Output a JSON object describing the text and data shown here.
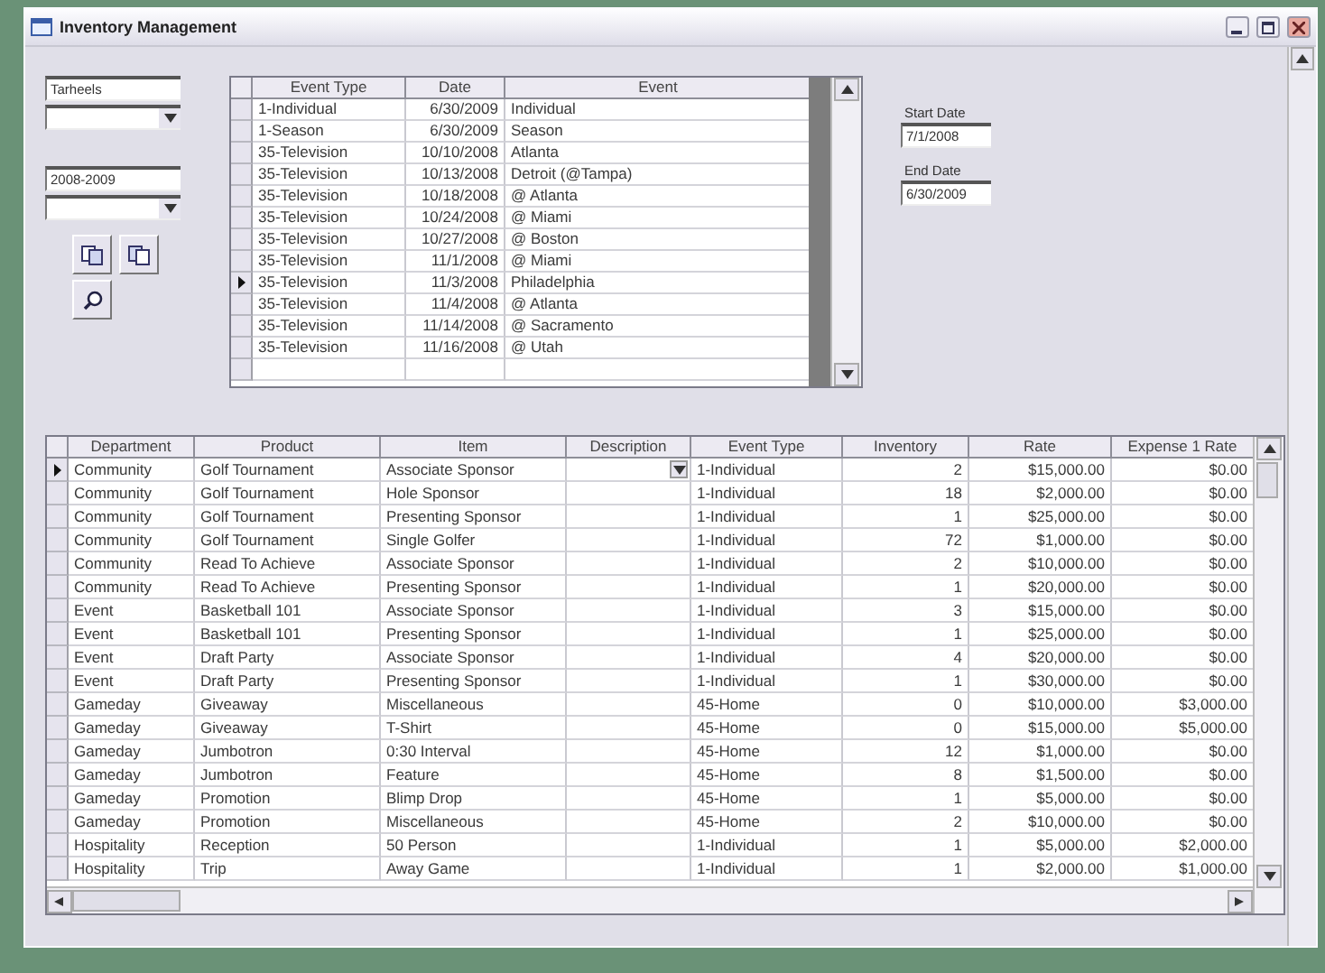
{
  "window": {
    "title": "Inventory Management"
  },
  "filters": {
    "team": {
      "value": "Tarheels"
    },
    "season": {
      "value": "2008-2009"
    }
  },
  "events_grid": {
    "columns": [
      {
        "label": "Event Type",
        "kind": "text"
      },
      {
        "label": "Date",
        "kind": "number"
      },
      {
        "label": "Event",
        "kind": "text"
      }
    ],
    "rows": [
      {
        "selected": false,
        "cells": [
          "1-Individual",
          "6/30/2009",
          "Individual"
        ]
      },
      {
        "selected": false,
        "cells": [
          "1-Season",
          "6/30/2009",
          "Season"
        ]
      },
      {
        "selected": false,
        "cells": [
          "35-Television",
          "10/10/2008",
          "Atlanta"
        ]
      },
      {
        "selected": false,
        "cells": [
          "35-Television",
          "10/13/2008",
          "Detroit (@Tampa)"
        ]
      },
      {
        "selected": false,
        "cells": [
          "35-Television",
          "10/18/2008",
          "@ Atlanta"
        ]
      },
      {
        "selected": false,
        "cells": [
          "35-Television",
          "10/24/2008",
          "@ Miami"
        ]
      },
      {
        "selected": false,
        "cells": [
          "35-Television",
          "10/27/2008",
          "@ Boston"
        ]
      },
      {
        "selected": false,
        "cells": [
          "35-Television",
          "11/1/2008",
          "@ Miami"
        ]
      },
      {
        "selected": true,
        "cells": [
          "35-Television",
          "11/3/2008",
          "Philadelphia"
        ]
      },
      {
        "selected": false,
        "cells": [
          "35-Television",
          "11/4/2008",
          "@ Atlanta"
        ]
      },
      {
        "selected": false,
        "cells": [
          "35-Television",
          "11/14/2008",
          "@ Sacramento"
        ]
      },
      {
        "selected": false,
        "cells": [
          "35-Television",
          "11/16/2008",
          "@ Utah"
        ]
      }
    ]
  },
  "dates": {
    "start": {
      "label": "Start Date",
      "value": "7/1/2008"
    },
    "end": {
      "label": "End Date",
      "value": "6/30/2009"
    }
  },
  "inventory_grid": {
    "columns": [
      {
        "label": "Department",
        "kind": "text"
      },
      {
        "label": "Product",
        "kind": "text"
      },
      {
        "label": "Item",
        "kind": "text"
      },
      {
        "label": "Description",
        "kind": "text"
      },
      {
        "label": "Event Type",
        "kind": "text"
      },
      {
        "label": "Inventory",
        "kind": "number"
      },
      {
        "label": "Rate",
        "kind": "number"
      },
      {
        "label": "Expense 1 Rate",
        "kind": "number"
      }
    ],
    "rows": [
      {
        "selected": true,
        "cells": [
          "Community",
          "Golf Tournament",
          "Associate Sponsor",
          "",
          "1-Individual",
          "2",
          "$15,000.00",
          "$0.00"
        ]
      },
      {
        "selected": false,
        "cells": [
          "Community",
          "Golf Tournament",
          "Hole Sponsor",
          "",
          "1-Individual",
          "18",
          "$2,000.00",
          "$0.00"
        ]
      },
      {
        "selected": false,
        "cells": [
          "Community",
          "Golf Tournament",
          "Presenting Sponsor",
          "",
          "1-Individual",
          "1",
          "$25,000.00",
          "$0.00"
        ]
      },
      {
        "selected": false,
        "cells": [
          "Community",
          "Golf Tournament",
          "Single Golfer",
          "",
          "1-Individual",
          "72",
          "$1,000.00",
          "$0.00"
        ]
      },
      {
        "selected": false,
        "cells": [
          "Community",
          "Read To Achieve",
          "Associate Sponsor",
          "",
          "1-Individual",
          "2",
          "$10,000.00",
          "$0.00"
        ]
      },
      {
        "selected": false,
        "cells": [
          "Community",
          "Read To Achieve",
          "Presenting Sponsor",
          "",
          "1-Individual",
          "1",
          "$20,000.00",
          "$0.00"
        ]
      },
      {
        "selected": false,
        "cells": [
          "Event",
          "Basketball 101",
          "Associate Sponsor",
          "",
          "1-Individual",
          "3",
          "$15,000.00",
          "$0.00"
        ]
      },
      {
        "selected": false,
        "cells": [
          "Event",
          "Basketball 101",
          "Presenting Sponsor",
          "",
          "1-Individual",
          "1",
          "$25,000.00",
          "$0.00"
        ]
      },
      {
        "selected": false,
        "cells": [
          "Event",
          "Draft Party",
          "Associate Sponsor",
          "",
          "1-Individual",
          "4",
          "$20,000.00",
          "$0.00"
        ]
      },
      {
        "selected": false,
        "cells": [
          "Event",
          "Draft Party",
          "Presenting Sponsor",
          "",
          "1-Individual",
          "1",
          "$30,000.00",
          "$0.00"
        ]
      },
      {
        "selected": false,
        "cells": [
          "Gameday",
          "Giveaway",
          "Miscellaneous",
          "",
          "45-Home",
          "0",
          "$10,000.00",
          "$3,000.00"
        ]
      },
      {
        "selected": false,
        "cells": [
          "Gameday",
          "Giveaway",
          "T-Shirt",
          "",
          "45-Home",
          "0",
          "$15,000.00",
          "$5,000.00"
        ]
      },
      {
        "selected": false,
        "cells": [
          "Gameday",
          "Jumbotron",
          "0:30 Interval",
          "",
          "45-Home",
          "12",
          "$1,000.00",
          "$0.00"
        ]
      },
      {
        "selected": false,
        "cells": [
          "Gameday",
          "Jumbotron",
          "Feature",
          "",
          "45-Home",
          "8",
          "$1,500.00",
          "$0.00"
        ]
      },
      {
        "selected": false,
        "cells": [
          "Gameday",
          "Promotion",
          "Blimp Drop",
          "",
          "45-Home",
          "1",
          "$5,000.00",
          "$0.00"
        ]
      },
      {
        "selected": false,
        "cells": [
          "Gameday",
          "Promotion",
          "Miscellaneous",
          "",
          "45-Home",
          "2",
          "$10,000.00",
          "$0.00"
        ]
      },
      {
        "selected": false,
        "cells": [
          "Hospitality",
          "Reception",
          "50 Person",
          "",
          "1-Individual",
          "1",
          "$5,000.00",
          "$2,000.00"
        ]
      },
      {
        "selected": false,
        "cells": [
          "Hospitality",
          "Trip",
          "Away Game",
          "",
          "1-Individual",
          "1",
          "$2,000.00",
          "$1,000.00"
        ]
      }
    ]
  }
}
